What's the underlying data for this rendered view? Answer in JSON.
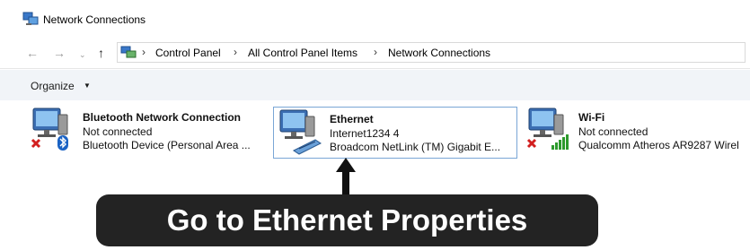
{
  "window": {
    "title": "Network Connections"
  },
  "address": {
    "crumbs": [
      "Control Panel",
      "All Control Panel Items",
      "Network Connections"
    ]
  },
  "toolbar": {
    "organize_label": "Organize"
  },
  "items": [
    {
      "name": "Bluetooth Network Connection",
      "status": "Not connected",
      "device": "Bluetooth Device (Personal Area ..."
    },
    {
      "name": "Ethernet",
      "status": "Internet1234 4",
      "device": "Broadcom NetLink (TM) Gigabit E..."
    },
    {
      "name": "Wi-Fi",
      "status": "Not connected",
      "device": "Qualcomm Atheros AR9287 Wirel"
    }
  ],
  "callout": {
    "text": "Go to Ethernet Properties"
  },
  "colors": {
    "callout_bg": "#232323",
    "selection_border": "#7aa6d6",
    "toolbar_bg": "#f1f4f8"
  }
}
